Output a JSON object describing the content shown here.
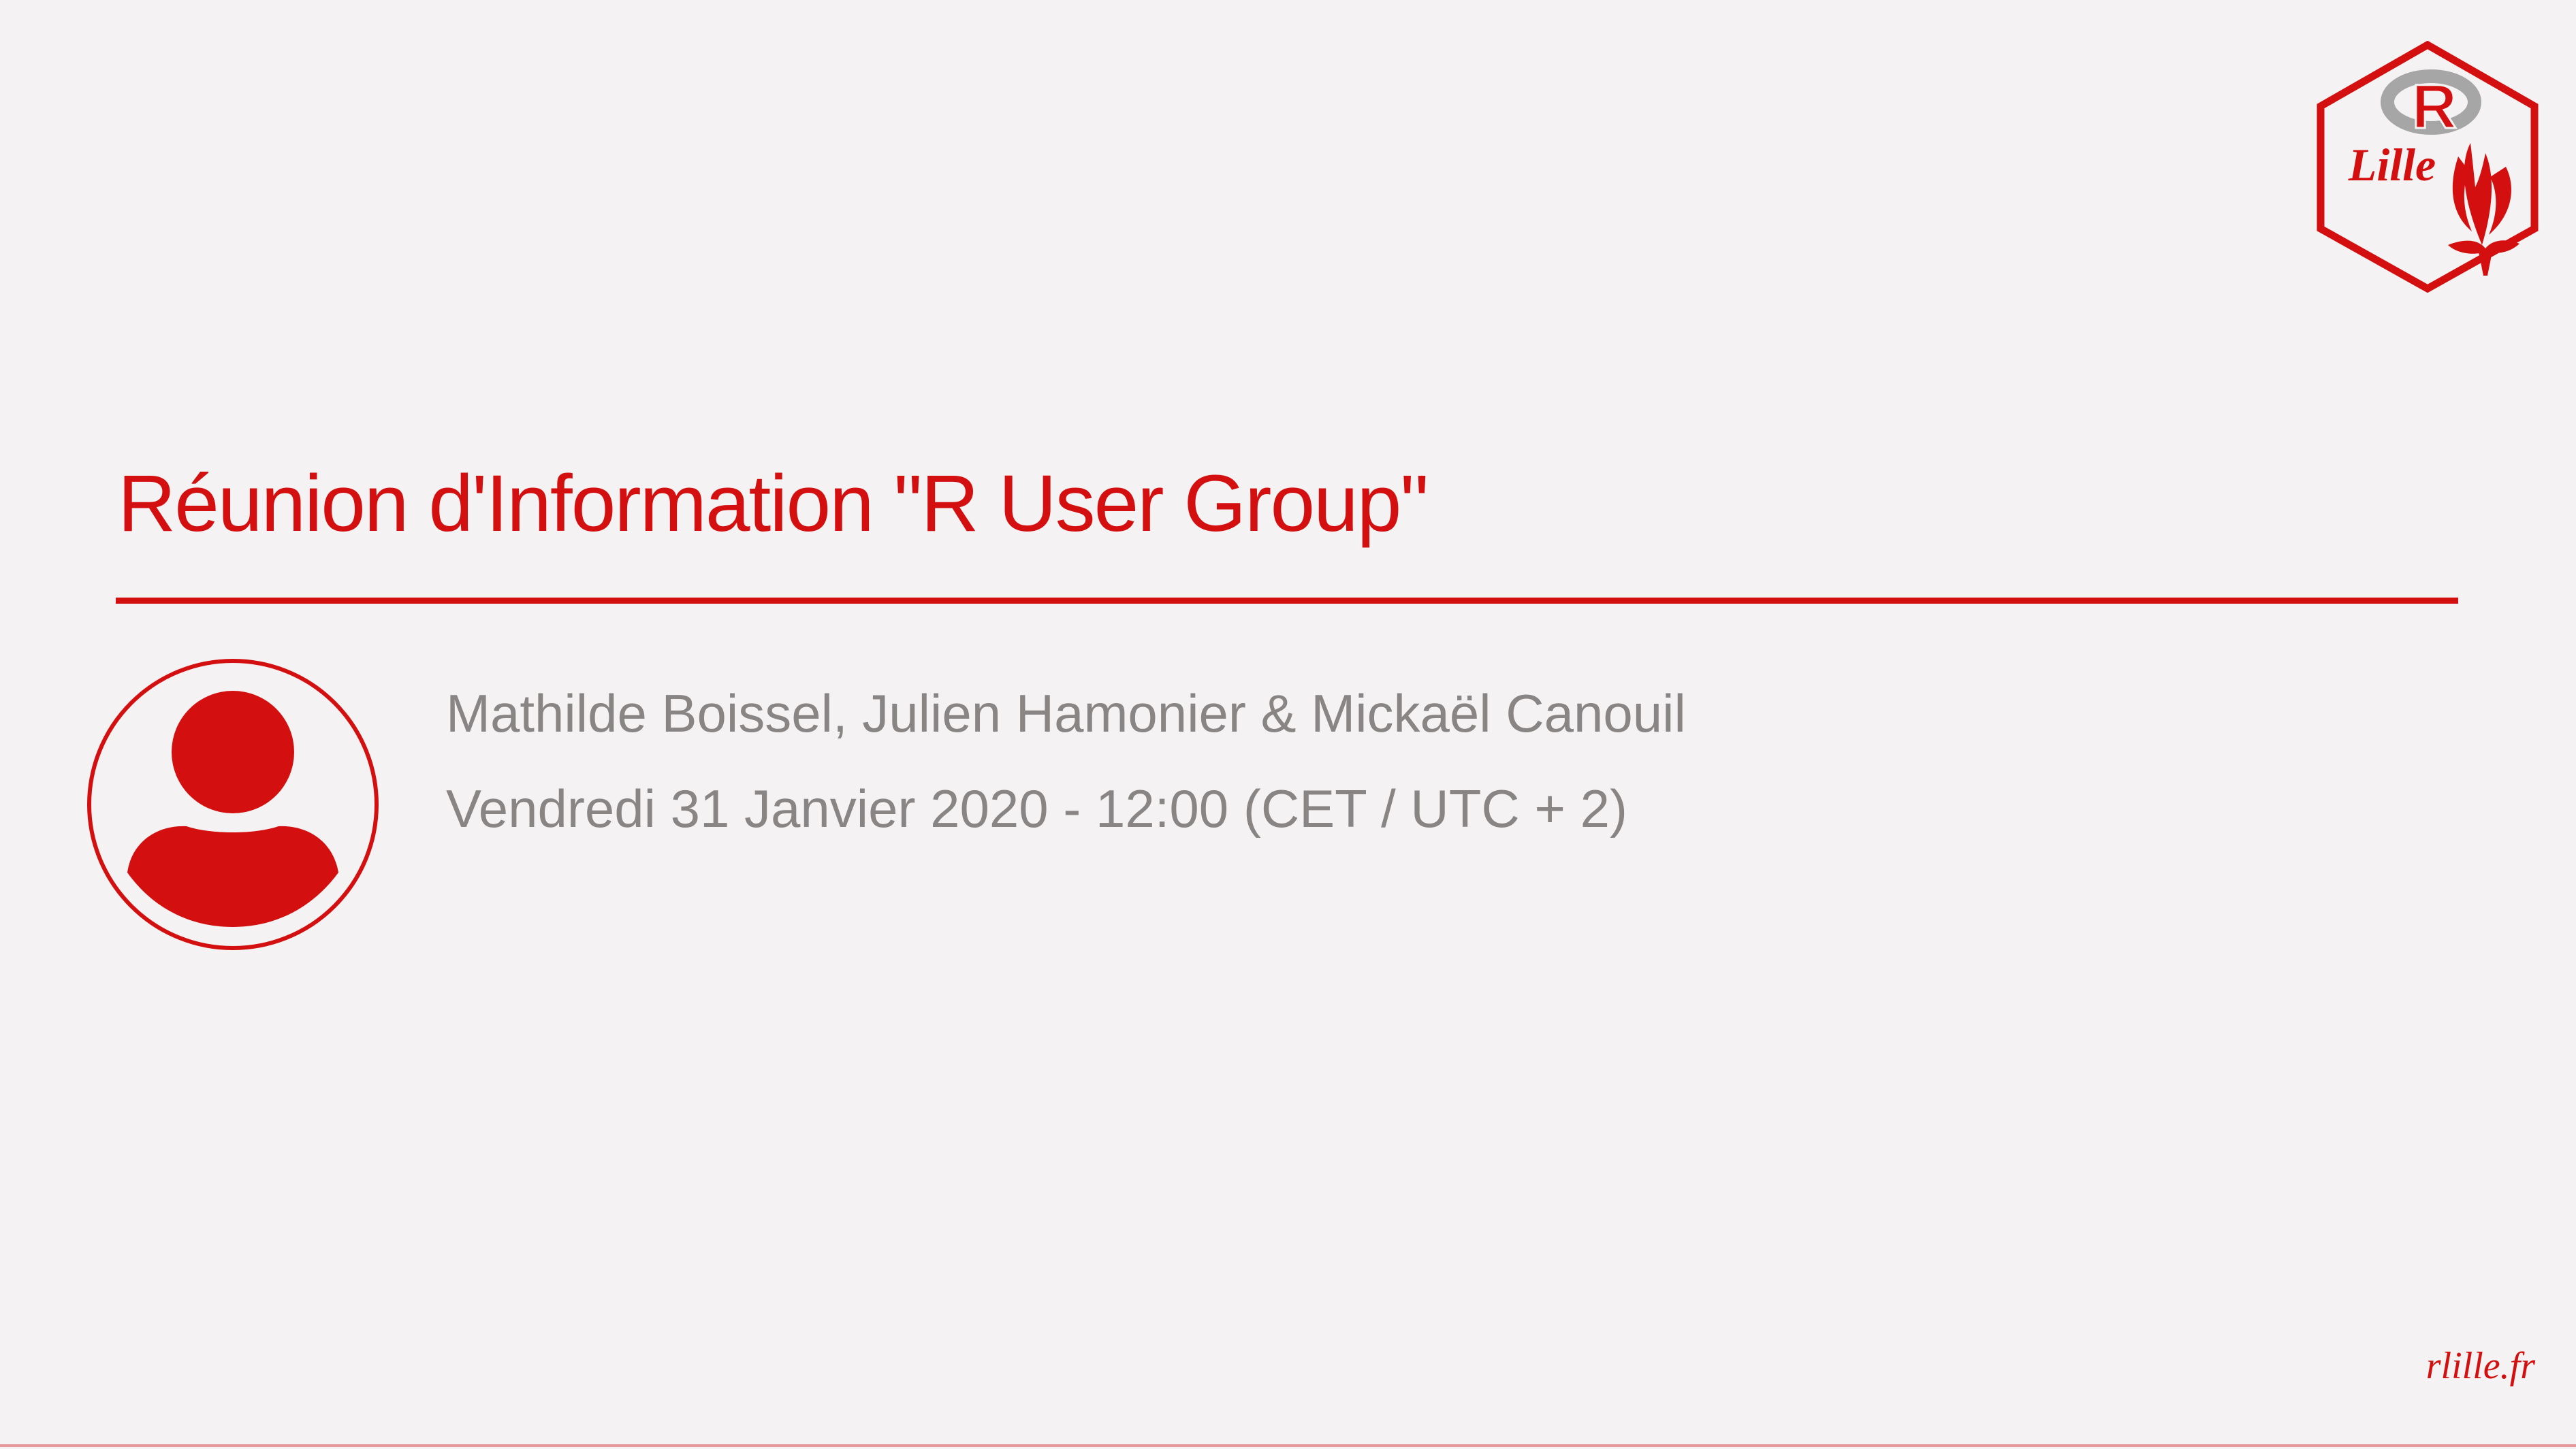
{
  "logo": {
    "letter": "R",
    "city": "Lille"
  },
  "slide": {
    "title": "Réunion d'Information \"R User Group\"",
    "authors": "Mathilde Boissel, Julien Hamonier & Mickaël Canouil",
    "date": "Vendredi 31 Janvier 2020 - 12:00 (CET / UTC + 2)"
  },
  "footer": {
    "link": "rlille.fr"
  },
  "colors": {
    "accent": "#d40f0f",
    "background": "#f4f2f2",
    "text_muted": "#8a8585",
    "logo_ring": "#a6a6a6"
  },
  "icons": {
    "avatar": "user-avatar-icon",
    "logo": "r-lille-hex-logo"
  }
}
